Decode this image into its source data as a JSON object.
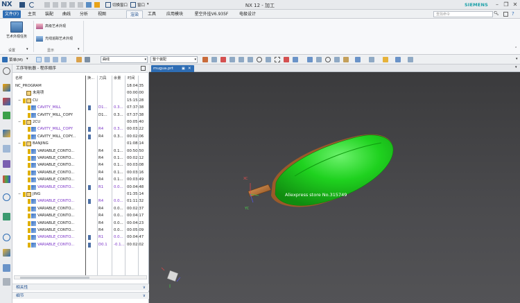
{
  "app": {
    "logo": "NX",
    "window_title": "NX 12 - 加工",
    "brand": "SIEMENS",
    "quick_access": {
      "switch_window": "切换窗口",
      "window": "窗口"
    }
  },
  "menu": {
    "tabs": [
      "文件(F)",
      "主页",
      "装配",
      "曲线",
      "分析",
      "视图",
      "渲染",
      "工具",
      "应用模块",
      "星空外挂V6.935F",
      "电极设计"
    ],
    "active_tab": "渲染",
    "search_placeholder": "查找命令"
  },
  "ribbon": {
    "big_button": "艺术外观任务",
    "small_buttons": [
      "高级艺术外观",
      "光线追踪艺术外观"
    ],
    "group_labels": [
      "设置",
      "显示"
    ]
  },
  "toolbar": {
    "menu_label": "菜单(M)",
    "filter_dropdown": "曲线",
    "assembly_dropdown": "整个装配"
  },
  "navigator": {
    "title": "工序导航器 - 程序顺序",
    "columns": [
      "名称",
      "换...",
      "刀具",
      "余量",
      "时间"
    ],
    "rows": [
      {
        "name": "NC_PROGRAM",
        "tool": "",
        "stock": "",
        "time": "18:04:35",
        "purple": false,
        "level": 0,
        "kind": "root",
        "changed": false
      },
      {
        "name": "未用项",
        "tool": "",
        "stock": "",
        "time": "00:00:00",
        "purple": false,
        "level": 1,
        "kind": "folder",
        "changed": false
      },
      {
        "name": "CU",
        "tool": "",
        "stock": "",
        "time": "15:15:28",
        "purple": false,
        "level": 1,
        "kind": "program",
        "changed": false
      },
      {
        "name": "CAVITY_MILL",
        "tool": "D1...",
        "stock": "0.3...",
        "time": "07:37:38",
        "purple": true,
        "level": 2,
        "kind": "op",
        "changed": true
      },
      {
        "name": "CAVITY_MILL_COPY",
        "tool": "D1...",
        "stock": "0.3...",
        "time": "07:37:38",
        "purple": false,
        "level": 2,
        "kind": "op",
        "changed": false
      },
      {
        "name": "2CU",
        "tool": "",
        "stock": "",
        "time": "00:05:40",
        "purple": false,
        "level": 1,
        "kind": "program",
        "changed": false
      },
      {
        "name": "CAVITY_MILL_COPY",
        "tool": "R4",
        "stock": "0.3...",
        "time": "00:03:22",
        "purple": true,
        "level": 2,
        "kind": "op",
        "changed": true
      },
      {
        "name": "CAVITY_MILL_COPY...",
        "tool": "R4",
        "stock": "0.3...",
        "time": "00:02:06",
        "purple": false,
        "level": 2,
        "kind": "op",
        "changed": true
      },
      {
        "name": "BANJING",
        "tool": "",
        "stock": "",
        "time": "01:08:14",
        "purple": false,
        "level": 1,
        "kind": "program",
        "changed": false
      },
      {
        "name": "VARIABLE_CONTO...",
        "tool": "R4",
        "stock": "0.1...",
        "time": "00:50:50",
        "purple": false,
        "level": 2,
        "kind": "op",
        "changed": false
      },
      {
        "name": "VARIABLE_CONTO...",
        "tool": "R4",
        "stock": "0.1...",
        "time": "00:02:12",
        "purple": false,
        "level": 2,
        "kind": "op",
        "changed": false
      },
      {
        "name": "VARIABLE_CONTO...",
        "tool": "R4",
        "stock": "0.1...",
        "time": "00:03:08",
        "purple": false,
        "level": 2,
        "kind": "op",
        "changed": false
      },
      {
        "name": "VARIABLE_CONTO...",
        "tool": "R4",
        "stock": "0.1...",
        "time": "00:03:16",
        "purple": false,
        "level": 2,
        "kind": "op",
        "changed": false
      },
      {
        "name": "VARIABLE_CONTO...",
        "tool": "R4",
        "stock": "0.1...",
        "time": "00:03:49",
        "purple": false,
        "level": 2,
        "kind": "op",
        "changed": false
      },
      {
        "name": "VARIABLE_CONTO...",
        "tool": "R1",
        "stock": "0.0...",
        "time": "00:04:48",
        "purple": true,
        "level": 2,
        "kind": "op",
        "changed": true
      },
      {
        "name": "JING",
        "tool": "",
        "stock": "",
        "time": "01:35:14",
        "purple": false,
        "level": 1,
        "kind": "program",
        "changed": false
      },
      {
        "name": "VARIABLE_CONTO...",
        "tool": "R4",
        "stock": "0.0...",
        "time": "01:11:32",
        "purple": true,
        "level": 2,
        "kind": "op",
        "changed": true
      },
      {
        "name": "VARIABLE_CONTO...",
        "tool": "R4",
        "stock": "0.0...",
        "time": "00:02:37",
        "purple": false,
        "level": 2,
        "kind": "op",
        "changed": false
      },
      {
        "name": "VARIABLE_CONTO...",
        "tool": "R4",
        "stock": "0.0...",
        "time": "00:04:17",
        "purple": false,
        "level": 2,
        "kind": "op",
        "changed": false
      },
      {
        "name": "VARIABLE_CONTO...",
        "tool": "R4",
        "stock": "0.0...",
        "time": "00:04:23",
        "purple": false,
        "level": 2,
        "kind": "op",
        "changed": false
      },
      {
        "name": "VARIABLE_CONTO...",
        "tool": "R4",
        "stock": "0.0...",
        "time": "00:05:09",
        "purple": false,
        "level": 2,
        "kind": "op",
        "changed": false
      },
      {
        "name": "VARIABLE_CONTO...",
        "tool": "R1",
        "stock": "0.0...",
        "time": "00:04:47",
        "purple": true,
        "level": 2,
        "kind": "op",
        "changed": true
      },
      {
        "name": "VARIABLE_CONTO...",
        "tool": "D0.1",
        "stock": "-0.1...",
        "time": "00:02:02",
        "purple": true,
        "level": 2,
        "kind": "op",
        "changed": true
      }
    ],
    "bottom_panels": [
      "相关性",
      "细节"
    ]
  },
  "graphics": {
    "tab_label": "mugua.prt",
    "watermark": "Aliexpress store No.315749",
    "csys_labels": {
      "xc": "XC",
      "yc": "YC"
    }
  },
  "colors": {
    "accent": "#2e6db4",
    "purple_text": "#7b34c8",
    "part_green": "#1fd21f",
    "viewport_bg": "#444446"
  }
}
